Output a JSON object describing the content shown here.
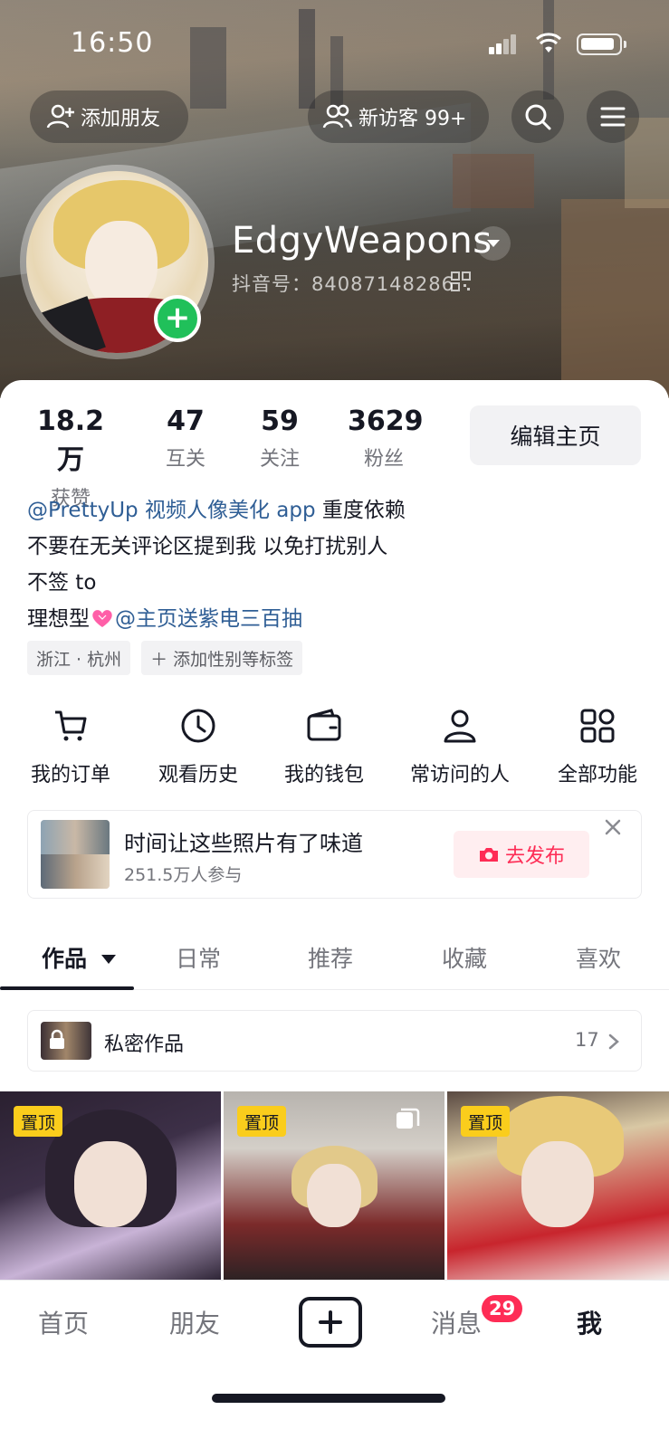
{
  "status_bar": {
    "time": "16:50"
  },
  "header": {
    "add_friend_label": "添加朋友",
    "visitors_label": "新访客 99+",
    "username": "EdgyWeapons",
    "douyin_id": "抖音号：84087148286"
  },
  "stats": [
    {
      "value": "18.2万",
      "label": "获赞"
    },
    {
      "value": "47",
      "label": "互关"
    },
    {
      "value": "59",
      "label": "关注"
    },
    {
      "value": "3629",
      "label": "粉丝"
    }
  ],
  "edit_profile_label": "编辑主页",
  "bio": {
    "line1_mention": "@PrettyUp 视频人像美化 app",
    "line1_text": " 重度依赖",
    "line2": "不要在无关评论区提到我 以免打扰别人",
    "line3": "不签 to",
    "line4_text": "理想型",
    "line4_mention": "@主页送紫电三百抽"
  },
  "tags": [
    "浙江 · 杭州",
    "＋ 添加性别等标签"
  ],
  "features": [
    {
      "label": "我的订单",
      "icon": "cart-icon"
    },
    {
      "label": "观看历史",
      "icon": "clock-icon"
    },
    {
      "label": "我的钱包",
      "icon": "wallet-icon"
    },
    {
      "label": "常访问的人",
      "icon": "person-icon"
    },
    {
      "label": "全部功能",
      "icon": "apps-icon"
    }
  ],
  "promo": {
    "title": "时间让这些照片有了味道",
    "subtitle": "251.5万人参与",
    "action_label": "去发布"
  },
  "tabs": [
    "作品",
    "日常",
    "推荐",
    "收藏",
    "喜欢"
  ],
  "private_works": {
    "label": "私密作品",
    "count": "17"
  },
  "grid": [
    {
      "badge": "置顶"
    },
    {
      "badge": "置顶"
    },
    {
      "badge": "置顶"
    }
  ],
  "bottom_nav": {
    "home": "首页",
    "friends": "朋友",
    "messages": "消息",
    "messages_badge": "29",
    "me": "我"
  },
  "colors": {
    "accent": "#fe2c55",
    "mention": "#2f5e95",
    "pin_badge": "#facd1c",
    "add_green": "#20c05a"
  }
}
